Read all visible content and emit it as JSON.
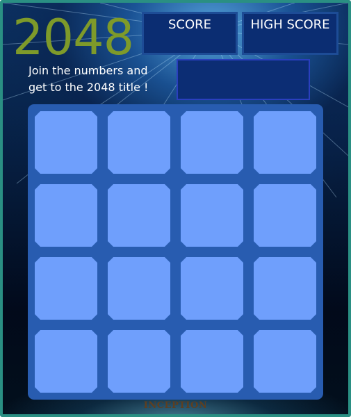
{
  "game": {
    "logo": "2048",
    "tagline": "Join the numbers and get to the 2048 title !"
  },
  "scores": {
    "score_label": "SCORE",
    "score_value": "",
    "high_label": "HIGH SCORE",
    "high_value": ""
  },
  "message": "",
  "board": {
    "rows": 4,
    "cols": 4,
    "cells": [
      [
        "",
        "",
        "",
        ""
      ],
      [
        "",
        "",
        "",
        ""
      ],
      [
        "",
        "",
        "",
        ""
      ],
      [
        "",
        "",
        "",
        ""
      ]
    ]
  },
  "footer": {
    "brand": "INCEPTION"
  },
  "colors": {
    "frame_border": "#2a8f83",
    "logo": "#7e9a2a",
    "score_box": "#0b2d72",
    "board": "#285cb0",
    "tile_empty": "#6f9ffc"
  }
}
